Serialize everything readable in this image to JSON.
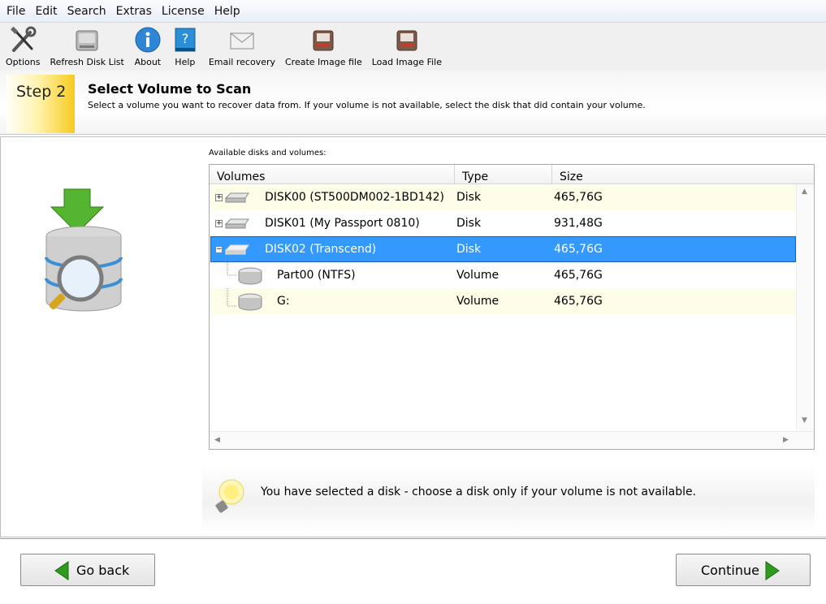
{
  "menu": [
    "File",
    "Edit",
    "Search",
    "Extras",
    "License",
    "Help"
  ],
  "toolbar": [
    {
      "label": "Options",
      "icon": "options-tools-icon"
    },
    {
      "label": "Refresh Disk List",
      "icon": "refresh-disk-icon"
    },
    {
      "label": "About",
      "icon": "about-info-icon"
    },
    {
      "label": "Help",
      "icon": "help-book-icon"
    },
    {
      "label": "Email recovery",
      "icon": "email-icon"
    },
    {
      "label": "Create Image file",
      "icon": "create-image-icon"
    },
    {
      "label": "Load Image File",
      "icon": "load-image-icon"
    }
  ],
  "step": {
    "badge": "Step 2",
    "title": "Select Volume to Scan",
    "description": "Select a volume you want to recover data from. If your volume is not available, select the disk that did contain your volume."
  },
  "list": {
    "caption": "Available disks and volumes:",
    "columns": [
      "Volumes",
      "Type",
      "Size"
    ],
    "rows": [
      {
        "name": "DISK00 (ST500DM002-1BD142)",
        "type": "Disk",
        "size": "465,76G",
        "expander": "+"
      },
      {
        "name": "DISK01 (My Passport 0810)",
        "type": "Disk",
        "size": "931,48G",
        "expander": "+"
      },
      {
        "name": "DISK02 (Transcend)",
        "type": "Disk",
        "size": "465,76G",
        "expander": "−"
      },
      {
        "name": "Part00 (NTFS)",
        "type": "Volume",
        "size": "465,76G"
      },
      {
        "name": "G:",
        "type": "Volume",
        "size": "465,76G"
      }
    ]
  },
  "info": {
    "message": "You have selected a disk - choose a disk only if your volume is not available."
  },
  "buttons": {
    "back": "Go back",
    "continue": "Continue"
  },
  "colors": {
    "selection": "#3399ff",
    "alt_row": "#fefde8",
    "step_badge": "#f7cc1e",
    "arrow_green": "#2e9a1e"
  }
}
